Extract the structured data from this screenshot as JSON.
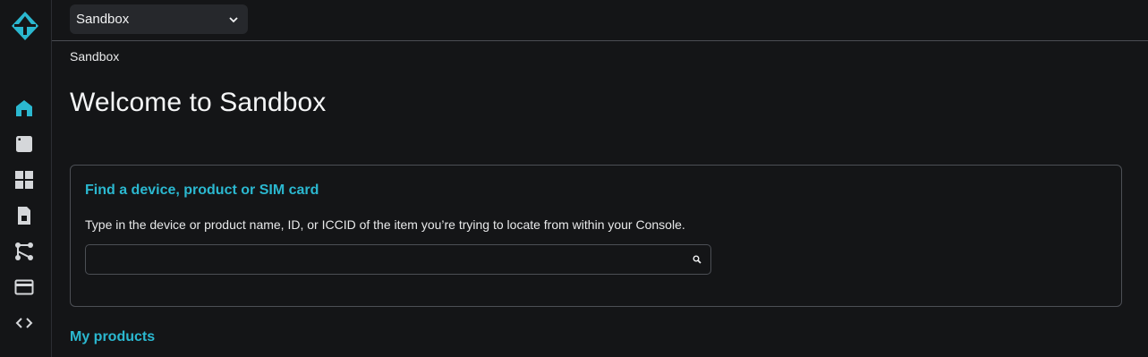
{
  "colors": {
    "accent": "#2bb8d0",
    "background": "#141517",
    "icon": "#d5d7da"
  },
  "sidebar": {
    "items": [
      {
        "icon": "home-icon",
        "active": true
      },
      {
        "icon": "device-icon",
        "active": false
      },
      {
        "icon": "dashboard-grid-icon",
        "active": false
      },
      {
        "icon": "document-icon",
        "active": false
      },
      {
        "icon": "integrations-icon",
        "active": false
      },
      {
        "icon": "billing-card-icon",
        "active": false
      },
      {
        "icon": "code-icon",
        "active": false
      }
    ]
  },
  "topbar": {
    "org_selected": "Sandbox"
  },
  "main": {
    "breadcrumb": "Sandbox",
    "title": "Welcome to Sandbox",
    "search_card": {
      "title": "Find a device, product or SIM card",
      "description": "Type in the device or product name, ID, or ICCID of the item you’re trying to locate from within your Console.",
      "input_value": "",
      "placeholder": ""
    },
    "products_heading": "My products"
  }
}
